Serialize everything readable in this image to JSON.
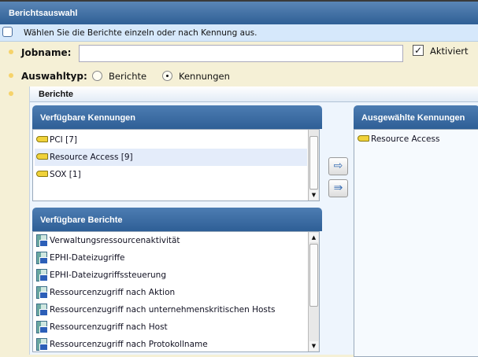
{
  "title": "Berichtsauswahl",
  "info": {
    "icon": "comment-icon",
    "text": "Wählen Sie die Berichte einzeln oder nach Kennung aus."
  },
  "form": {
    "jobname_label": "Jobname:",
    "jobname_value": "",
    "enabled_label": "Aktiviert",
    "enabled_checked": true,
    "selection_type_label": "Auswahltyp:",
    "option_reports": "Berichte",
    "option_tags": "Kennungen",
    "selected": "Kennungen"
  },
  "reports_section": {
    "title": "Berichte"
  },
  "available_tags": {
    "title": "Verfügbare Kennungen",
    "items": [
      {
        "label": "PCI [7]"
      },
      {
        "label": "Resource Access [9]",
        "selected": true
      },
      {
        "label": "SOX [1]"
      }
    ]
  },
  "available_reports": {
    "title": "Verfügbare Berichte",
    "items": [
      {
        "label": "Verwaltungsressourcenaktivität"
      },
      {
        "label": "EPHI-Dateizugriffe"
      },
      {
        "label": "EPHI-Dateizugriffssteuerung"
      },
      {
        "label": "Ressourcenzugriff nach Aktion"
      },
      {
        "label": "Ressourcenzugriff nach unternehmenskritischen Hosts"
      },
      {
        "label": "Ressourcenzugriff nach Host"
      },
      {
        "label": "Ressourcenzugriff nach Protokollname"
      }
    ]
  },
  "selected_tags": {
    "title": "Ausgewählte Kennungen",
    "items": [
      {
        "label": "Resource Access"
      }
    ]
  },
  "buttons": {
    "add": "arrow-right-icon",
    "add_all": "double-arrow-right-icon"
  }
}
